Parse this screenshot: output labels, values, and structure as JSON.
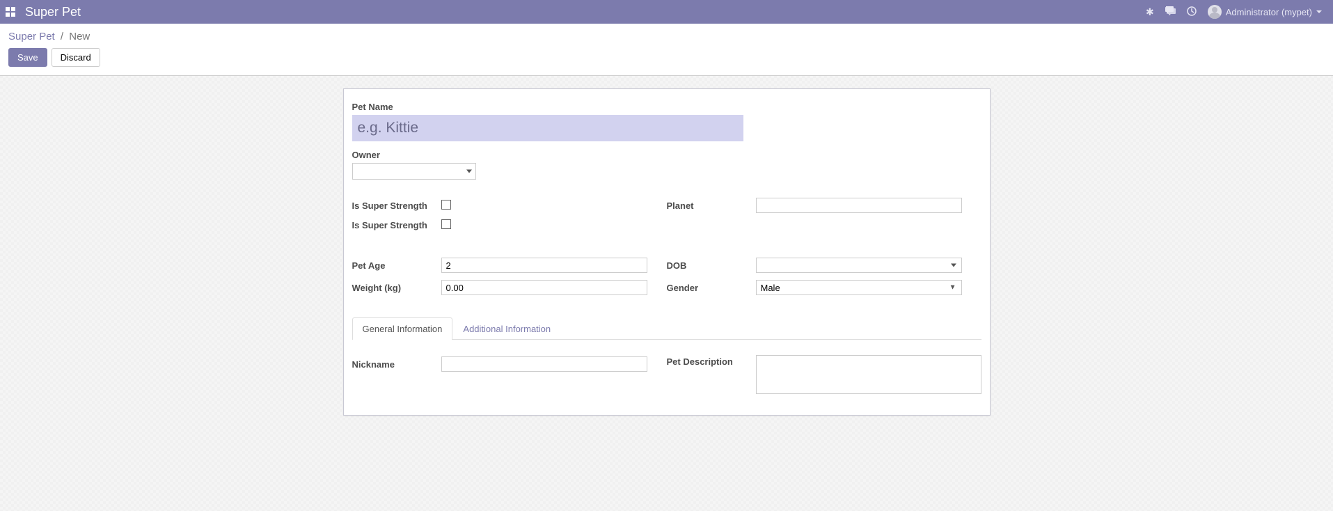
{
  "navbar": {
    "title": "Super Pet",
    "user_label": "Administrator (mypet)"
  },
  "breadcrumb": {
    "root": "Super Pet",
    "separator": "/",
    "current": "New"
  },
  "buttons": {
    "save": "Save",
    "discard": "Discard"
  },
  "form": {
    "pet_name": {
      "label": "Pet Name",
      "placeholder": "e.g. Kittie",
      "value": ""
    },
    "owner": {
      "label": "Owner",
      "value": ""
    },
    "is_super_strength_1": {
      "label": "Is Super Strength",
      "value": false
    },
    "is_super_strength_2": {
      "label": "Is Super Strength",
      "value": false
    },
    "planet": {
      "label": "Planet",
      "value": ""
    },
    "pet_age": {
      "label": "Pet Age",
      "value": "2"
    },
    "dob": {
      "label": "DOB",
      "value": ""
    },
    "weight": {
      "label": "Weight (kg)",
      "value": "0.00"
    },
    "gender": {
      "label": "Gender",
      "value": "Male"
    },
    "nickname": {
      "label": "Nickname",
      "value": ""
    },
    "pet_description": {
      "label": "Pet Description",
      "value": ""
    }
  },
  "tabs": {
    "general": "General Information",
    "additional": "Additional Information"
  }
}
